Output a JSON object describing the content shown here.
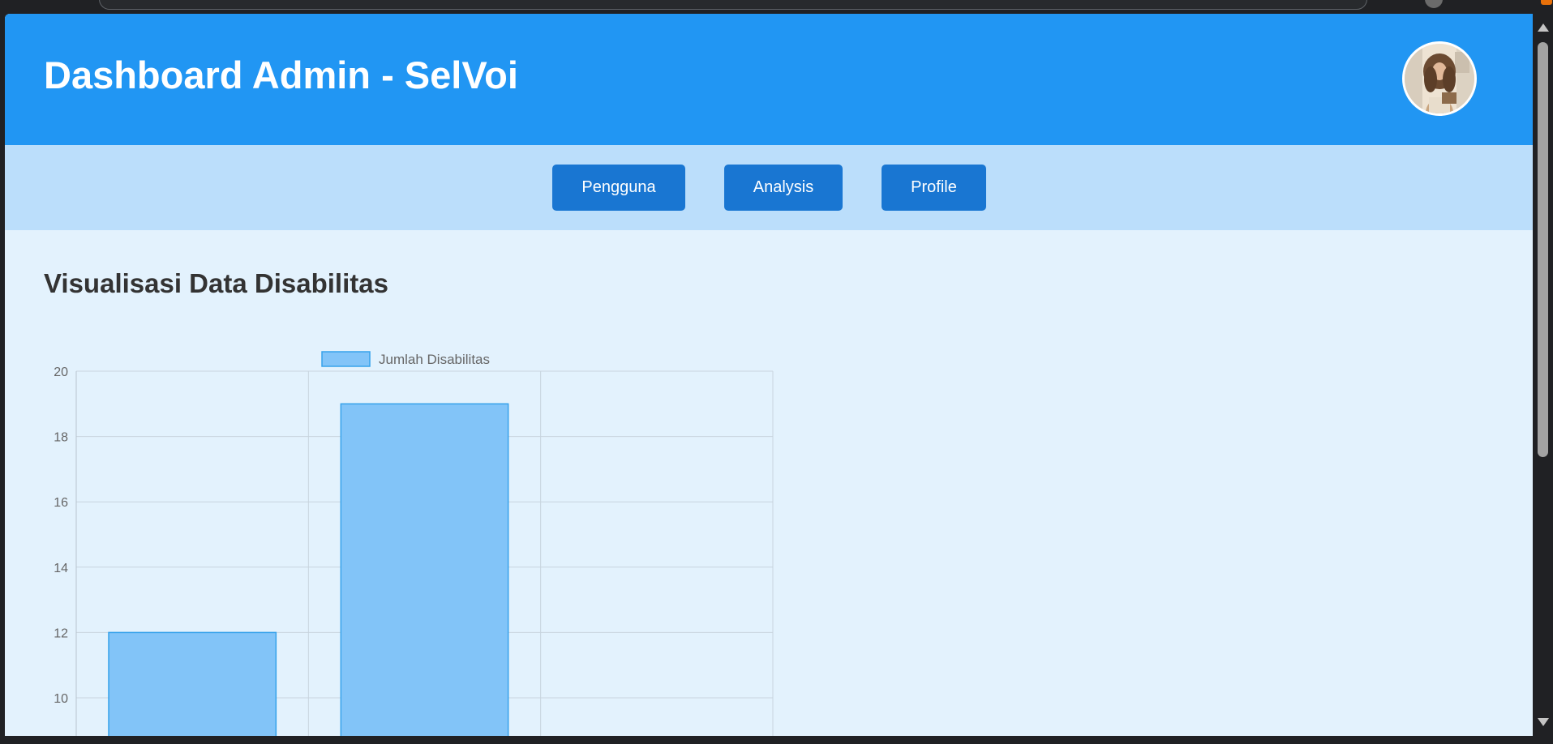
{
  "header": {
    "title": "Dashboard Admin - SelVoi"
  },
  "nav": {
    "buttons": [
      {
        "label": "Pengguna"
      },
      {
        "label": "Analysis"
      },
      {
        "label": "Profile"
      }
    ]
  },
  "main": {
    "section_title": "Visualisasi Data Disabilitas"
  },
  "colors": {
    "header": "#2196f3",
    "nav_bar": "#bbdefb",
    "nav_button": "#1976d2",
    "page_background": "#e3f2fd",
    "bar_fill": "#82c4f8",
    "bar_border": "#36a2eb"
  },
  "chart_data": {
    "type": "bar",
    "title": "",
    "xlabel": "",
    "ylabel": "",
    "categories": [
      "",
      "",
      ""
    ],
    "series": [
      {
        "name": "Jumlah Disabilitas",
        "values": [
          12,
          19,
          null
        ]
      }
    ],
    "ylim": [
      0,
      20
    ],
    "visible_ylim": [
      9,
      20
    ],
    "yticks": [
      "10",
      "12",
      "14",
      "16",
      "18",
      "20"
    ],
    "grid": true,
    "legend": "top-center"
  }
}
